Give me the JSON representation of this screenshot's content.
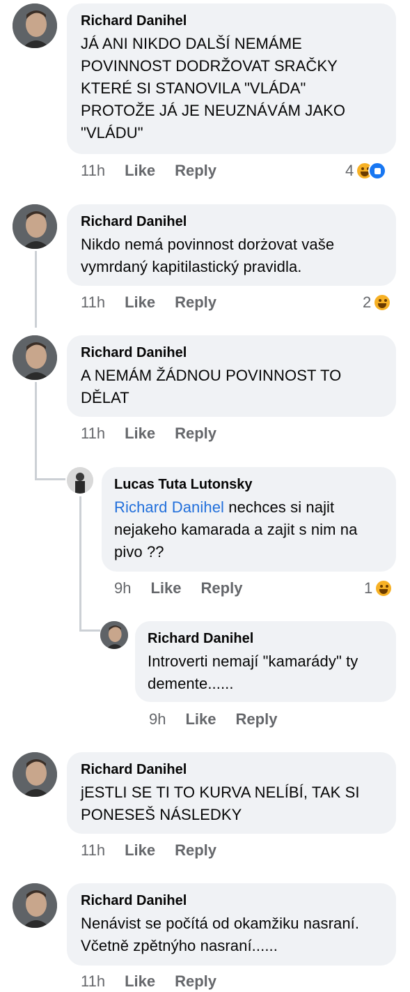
{
  "comments": [
    {
      "author": "Richard Danihel",
      "text": "JÁ ANI NIKDO DALŠÍ NEMÁME POVINNOST DODRŽOVAT SRAČKY KTERÉ SI STANOVILA \"VLÁDA\" PROTOŽE JÁ JE NEUZNÁVÁM JAKO \"VLÁDU\"",
      "time": "11h",
      "like": "Like",
      "reply": "Reply",
      "reactions_count": "4",
      "reactions": [
        "haha-icon",
        "like-icon"
      ]
    },
    {
      "author": "Richard Danihel",
      "text": "Nikdo nemá povinnost dorżovat vaše vymrdaný kapitilastický  pravidla.",
      "time": "11h",
      "like": "Like",
      "reply": "Reply",
      "reactions_count": "2",
      "reactions": [
        "haha-icon"
      ]
    },
    {
      "author": "Richard Danihel",
      "text": "A NEMÁM ŽÁDNOU POVINNOST TO DĚLAT",
      "time": "11h",
      "like": "Like",
      "reply": "Reply"
    },
    {
      "author": "Lucas Tuta Lutonsky",
      "mention": "Richard Danihel",
      "text": " nechces si najit nejakeho kamarada a zajit s nim na pivo ??",
      "time": "9h",
      "like": "Like",
      "reply": "Reply",
      "reactions_count": "1",
      "reactions": [
        "haha-icon"
      ]
    },
    {
      "author": "Richard Danihel",
      "text": "Introverti nemají \"kamarády\" ty demente......",
      "time": "9h",
      "like": "Like",
      "reply": "Reply"
    },
    {
      "author": "Richard Danihel",
      "text": "jESTLI SE TI TO KURVA NELÍBÍ, TAK SI PONESEŠ NÁSLEDKY",
      "time": "11h",
      "like": "Like",
      "reply": "Reply"
    },
    {
      "author": "Richard Danihel",
      "text": "Nenávist se počítá od okamžiku nasraní. Včetně zpětnýho nasraní......",
      "time": "11h",
      "like": "Like",
      "reply": "Reply"
    }
  ],
  "colors": {
    "bubble": "#f0f2f5",
    "meta": "#65676b",
    "mention": "#216fdb",
    "thread_line": "#ccd0d5"
  }
}
